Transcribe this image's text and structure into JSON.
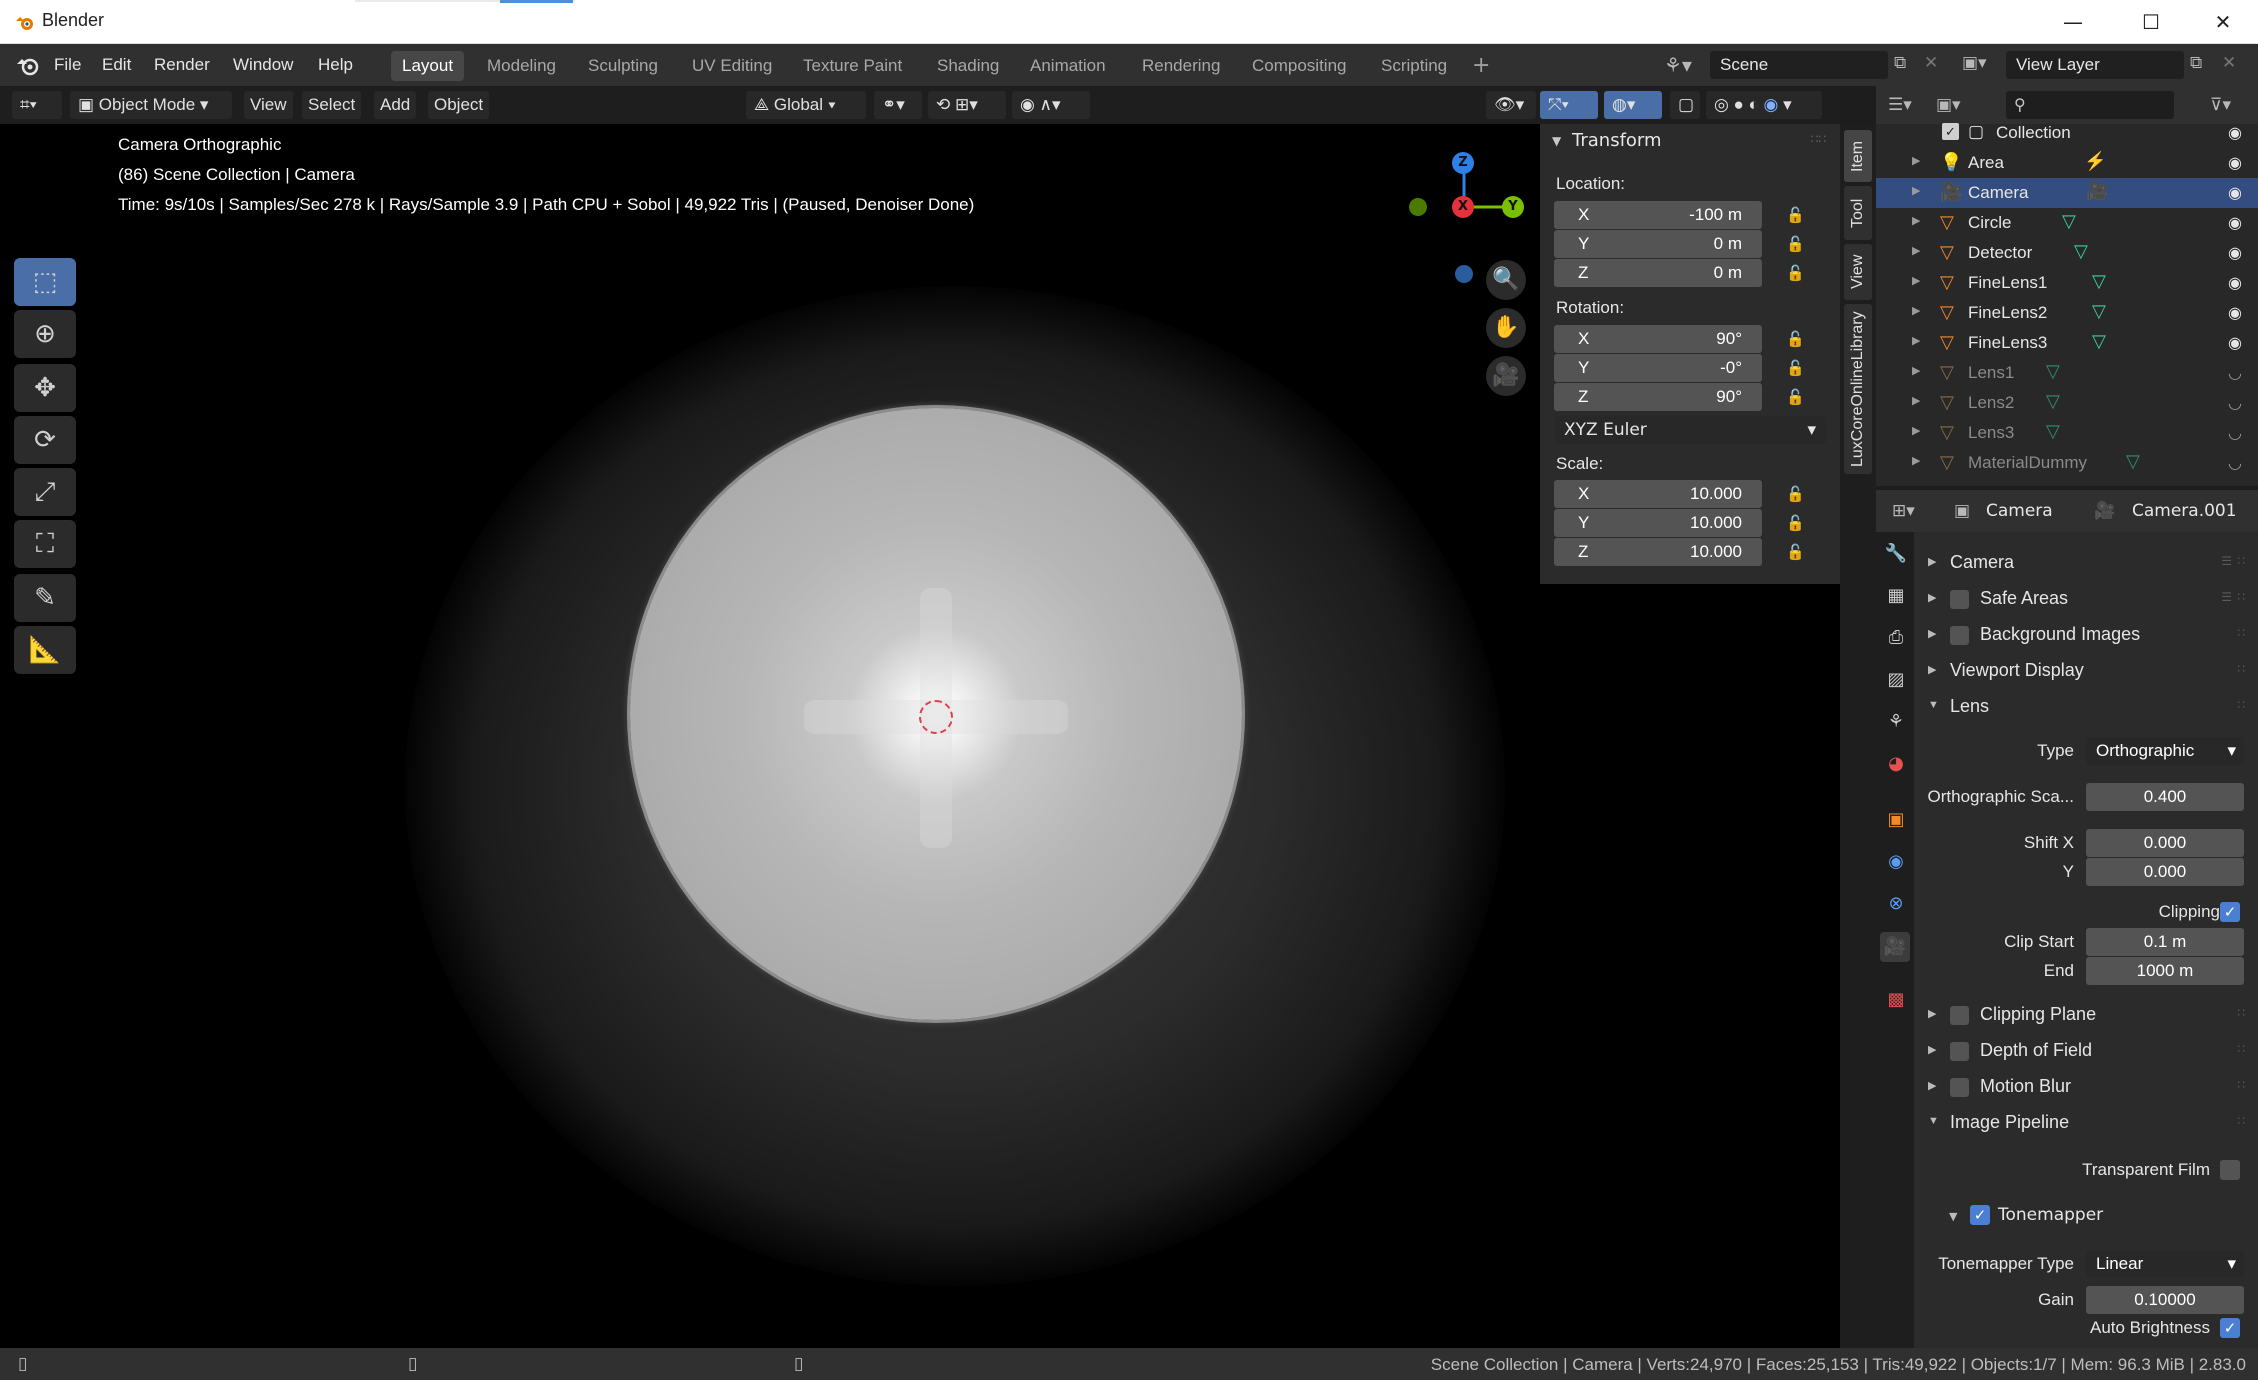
{
  "window": {
    "title": "Blender",
    "minimize": "—",
    "maximize": "☐",
    "close": "✕"
  },
  "menu": [
    "File",
    "Edit",
    "Render",
    "Window",
    "Help"
  ],
  "workspaces": [
    "Layout",
    "Modeling",
    "Sculpting",
    "UV Editing",
    "Texture Paint",
    "Shading",
    "Animation",
    "Rendering",
    "Compositing",
    "Scripting"
  ],
  "scene": {
    "name": "Scene",
    "view_layer": "View Layer"
  },
  "viewport_header": {
    "mode": "Object Mode",
    "menus": [
      "View",
      "Select",
      "Add",
      "Object"
    ],
    "orientation": "Global"
  },
  "overlay": {
    "line1": "Camera Orthographic",
    "line2": "(86) Scene Collection | Camera",
    "line3": "Time: 9s/10s | Samples/Sec 278 k | Rays/Sample 3.9 | Path CPU + Sobol | 49,922 Tris | (Paused, Denoiser Done)"
  },
  "gizmo": {
    "x": "X",
    "y": "Y",
    "z": "Z"
  },
  "npanel": {
    "tabs": [
      "Item",
      "Tool",
      "View",
      "LuxCoreOnlineLibrary"
    ],
    "title": "Transform",
    "location_label": "Location:",
    "location": [
      {
        "axis": "X",
        "value": "-100 m"
      },
      {
        "axis": "Y",
        "value": "0 m"
      },
      {
        "axis": "Z",
        "value": "0 m"
      }
    ],
    "rotation_label": "Rotation:",
    "rotation": [
      {
        "axis": "X",
        "value": "90°"
      },
      {
        "axis": "Y",
        "value": "-0°"
      },
      {
        "axis": "Z",
        "value": "90°"
      }
    ],
    "rotation_mode": "XYZ Euler",
    "scale_label": "Scale:",
    "scale": [
      {
        "axis": "X",
        "value": "10.000"
      },
      {
        "axis": "Y",
        "value": "10.000"
      },
      {
        "axis": "Z",
        "value": "10.000"
      }
    ]
  },
  "outliner": {
    "collection": "Collection",
    "items": [
      {
        "name": "Area",
        "icon": "light-icon",
        "selected": false,
        "dim": false
      },
      {
        "name": "Camera",
        "icon": "camera-icon",
        "selected": true,
        "dim": false
      },
      {
        "name": "Circle",
        "icon": "mesh-icon",
        "selected": false,
        "dim": false
      },
      {
        "name": "Detector",
        "icon": "mesh-icon",
        "selected": false,
        "dim": false
      },
      {
        "name": "FineLens1",
        "icon": "mesh-icon",
        "selected": false,
        "dim": false
      },
      {
        "name": "FineLens2",
        "icon": "mesh-icon",
        "selected": false,
        "dim": false
      },
      {
        "name": "FineLens3",
        "icon": "mesh-icon",
        "selected": false,
        "dim": false
      },
      {
        "name": "Lens1",
        "icon": "mesh-icon",
        "selected": false,
        "dim": true
      },
      {
        "name": "Lens2",
        "icon": "mesh-icon",
        "selected": false,
        "dim": true
      },
      {
        "name": "Lens3",
        "icon": "mesh-icon",
        "selected": false,
        "dim": true
      },
      {
        "name": "MaterialDummy",
        "icon": "mesh-icon",
        "selected": false,
        "dim": true
      }
    ]
  },
  "properties": {
    "object": "Camera",
    "data": "Camera.001",
    "sections": {
      "camera": "Camera",
      "safe_areas": "Safe Areas",
      "background_images": "Background Images",
      "viewport_display": "Viewport Display",
      "lens": "Lens",
      "clipping_plane": "Clipping Plane",
      "depth_of_field": "Depth of Field",
      "motion_blur": "Motion Blur",
      "image_pipeline": "Image Pipeline",
      "tonemapper": "Tonemapper"
    },
    "lens": {
      "type_label": "Type",
      "type": "Orthographic",
      "ortho_label": "Orthographic Sca...",
      "ortho": "0.400",
      "shiftx_label": "Shift X",
      "shiftx": "0.000",
      "shifty_label": "Y",
      "shifty": "0.000",
      "clipping_label": "Clipping",
      "clip_start_label": "Clip Start",
      "clip_start": "0.1 m",
      "clip_end_label": "End",
      "clip_end": "1000 m"
    },
    "pipeline": {
      "transparent_label": "Transparent Film",
      "tm_type_label": "Tonemapper Type",
      "tm_type": "Linear",
      "gain_label": "Gain",
      "gain": "0.10000",
      "auto_label": "Auto Brightness"
    }
  },
  "status": "Scene Collection | Camera | Verts:24,970 | Faces:25,153 | Tris:49,922 | Objects:1/7 | Mem: 96.3 MiB | 2.83.0"
}
